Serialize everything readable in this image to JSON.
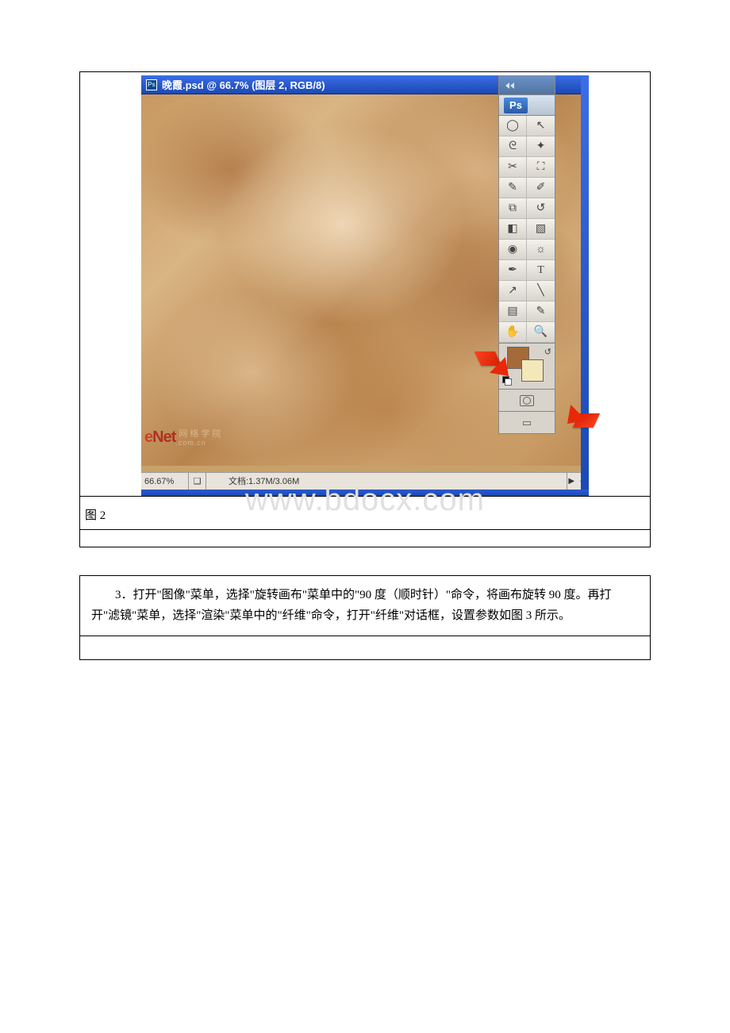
{
  "window": {
    "title": "晚霞.psd @ 66.7% (图层 2, RGB/8)",
    "ps_badge": "Ps"
  },
  "status": {
    "zoom": "66.67%",
    "doc": "文档:1.37M/3.06M",
    "arrows": "▶ ◀"
  },
  "colors": {
    "foreground": "#a56a3a",
    "background": "#f4e8b8"
  },
  "watermark": {
    "enet_logo_e": "e",
    "enet_logo_rest": "Net",
    "enet_cn": "网络学院",
    "enet_com": ".com.cn",
    "bdocx": "www.bdocx.com"
  },
  "caption": "图 2",
  "instruction": "3．打开\"图像\"菜单，选择\"旋转画布\"菜单中的\"90 度（顺时针）\"命令，将画布旋转 90 度。再打开\"滤镜\"菜单，选择\"渲染\"菜单中的\"纤维\"命令，打开\"纤维\"对话框，设置参数如图 3 所示。",
  "tools": [
    {
      "name": "marquee-tool",
      "glyph": "◯"
    },
    {
      "name": "move-tool",
      "glyph": "↖"
    },
    {
      "name": "lasso-tool",
      "glyph": "ᘓ"
    },
    {
      "name": "wand-tool",
      "glyph": "✦"
    },
    {
      "name": "crop-tool",
      "glyph": "✂"
    },
    {
      "name": "slice-tool",
      "glyph": "⛶"
    },
    {
      "name": "brush-tool",
      "glyph": "✎"
    },
    {
      "name": "pencil-tool",
      "glyph": "✐"
    },
    {
      "name": "stamp-tool",
      "glyph": "⧉"
    },
    {
      "name": "history-brush-tool",
      "glyph": "↺"
    },
    {
      "name": "eraser-tool",
      "glyph": "◧"
    },
    {
      "name": "gradient-tool",
      "glyph": "▧"
    },
    {
      "name": "blur-tool",
      "glyph": "◉"
    },
    {
      "name": "dodge-tool",
      "glyph": "☼"
    },
    {
      "name": "pen-tool",
      "glyph": "✒"
    },
    {
      "name": "type-tool",
      "glyph": "T"
    },
    {
      "name": "path-tool",
      "glyph": "↗"
    },
    {
      "name": "line-tool",
      "glyph": "╲"
    },
    {
      "name": "notes-tool",
      "glyph": "▤"
    },
    {
      "name": "eyedropper-tool",
      "glyph": "✎"
    },
    {
      "name": "hand-tool",
      "glyph": "✋"
    },
    {
      "name": "zoom-tool",
      "glyph": "🔍"
    }
  ]
}
